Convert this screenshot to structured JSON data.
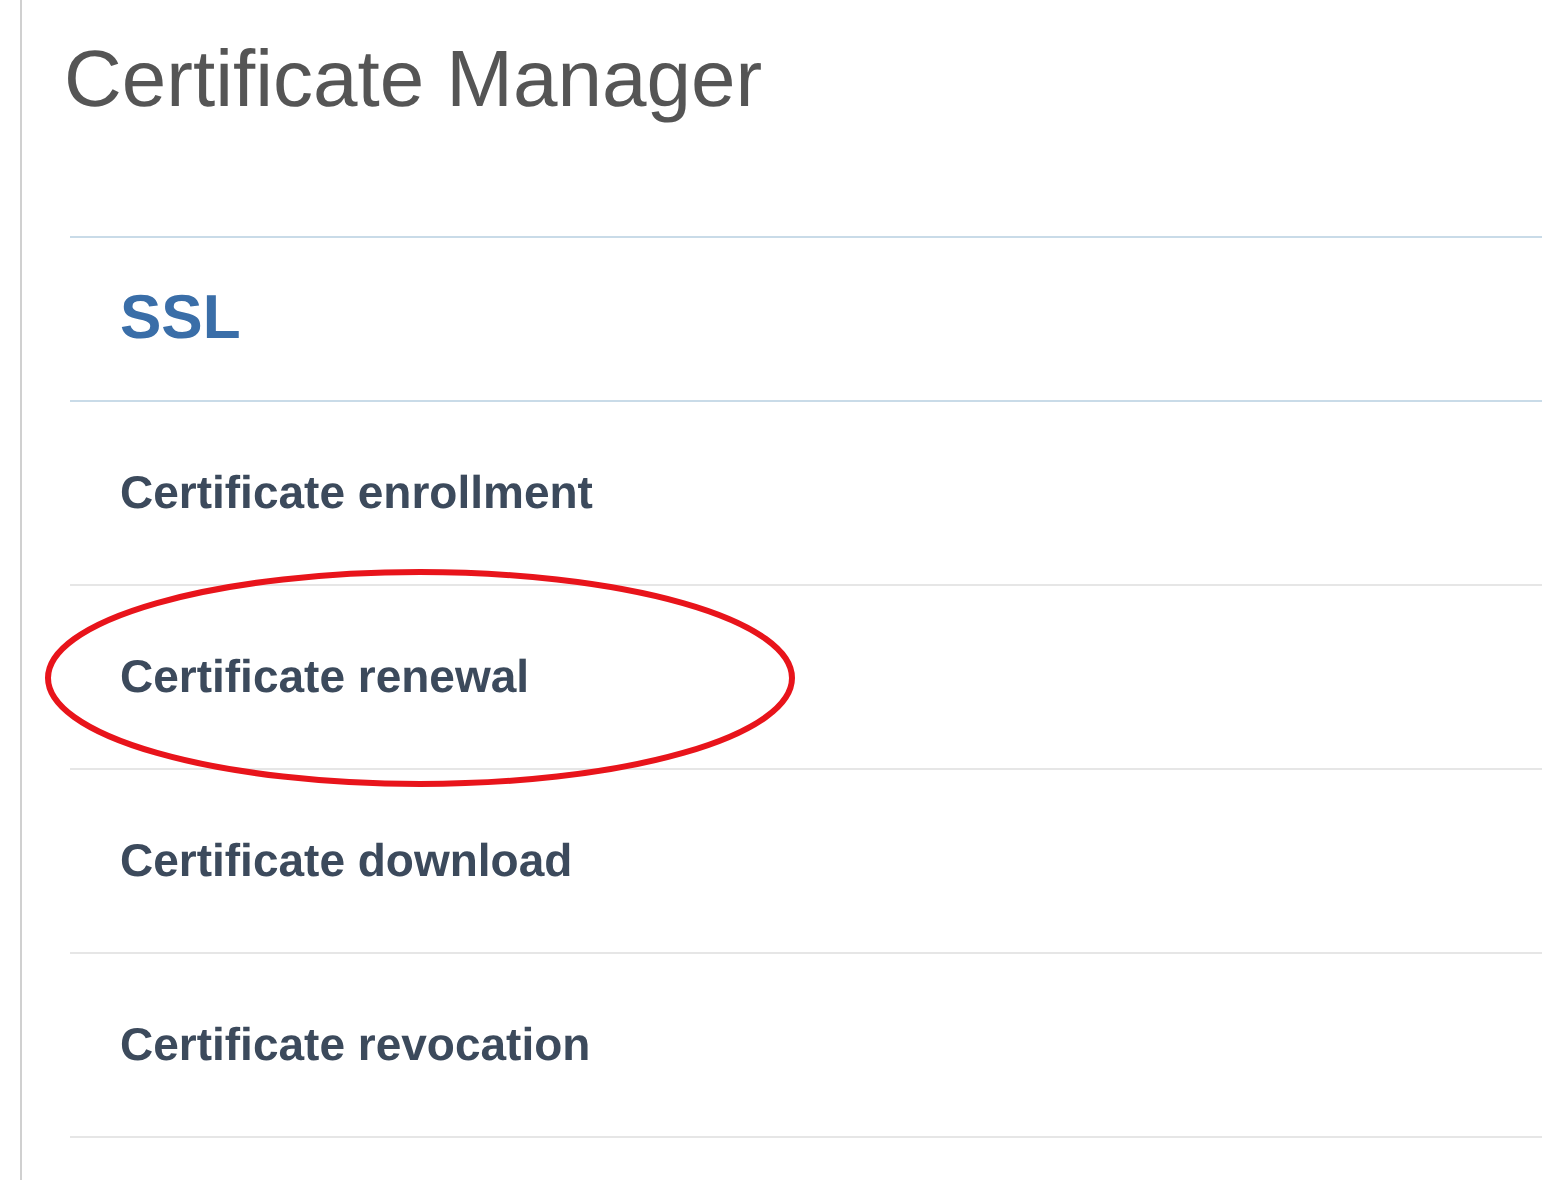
{
  "title": "Certificate Manager",
  "section": {
    "heading": "SSL",
    "items": [
      {
        "label": "Certificate enrollment",
        "circled": false
      },
      {
        "label": "Certificate renewal",
        "circled": true
      },
      {
        "label": "Certificate download",
        "circled": false
      },
      {
        "label": "Certificate revocation",
        "circled": false
      }
    ]
  }
}
